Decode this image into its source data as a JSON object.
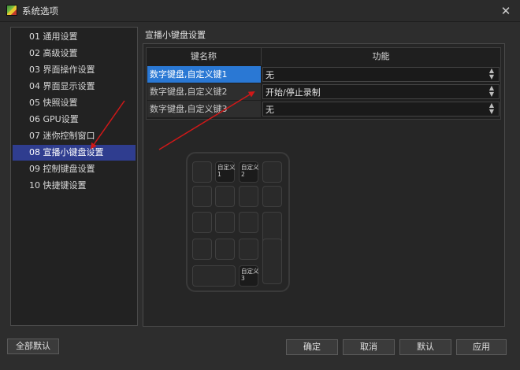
{
  "window": {
    "title": "系统选项"
  },
  "sidebar": {
    "items": [
      {
        "label": "01 通用设置"
      },
      {
        "label": "02 高级设置"
      },
      {
        "label": "03 界面操作设置"
      },
      {
        "label": "04 界面显示设置"
      },
      {
        "label": "05 快照设置"
      },
      {
        "label": "06 GPU设置"
      },
      {
        "label": "07 迷你控制窗口"
      },
      {
        "label": "08 宣播小键盘设置",
        "active": true
      },
      {
        "label": "09 控制键盘设置"
      },
      {
        "label": "10 快捷键设置"
      }
    ]
  },
  "main": {
    "title": "宣播小键盘设置",
    "table": {
      "headers": [
        "键名称",
        "功能"
      ],
      "rows": [
        {
          "name": "数字键盘,自定义键1",
          "function": "无",
          "selected": true
        },
        {
          "name": "数字键盘,自定义键2",
          "function": "开始/停止录制"
        },
        {
          "name": "数字键盘,自定义键3",
          "function": "无"
        }
      ]
    },
    "keypad": {
      "custom_keys": [
        {
          "label": "自定义",
          "number": "1"
        },
        {
          "label": "自定义",
          "number": "2"
        },
        {
          "label": "自定义",
          "number": "3"
        }
      ]
    }
  },
  "footer": {
    "reset_all": "全部默认",
    "ok": "确定",
    "cancel": "取消",
    "default": "默认",
    "apply": "应用"
  },
  "colors": {
    "selection": "#2f3d8f",
    "row_selected": "#2a78d4",
    "annotation": "#d01818"
  },
  "icons": {
    "app": "app-icon",
    "close": "close-icon",
    "dropdown": "updown-arrows-icon"
  }
}
